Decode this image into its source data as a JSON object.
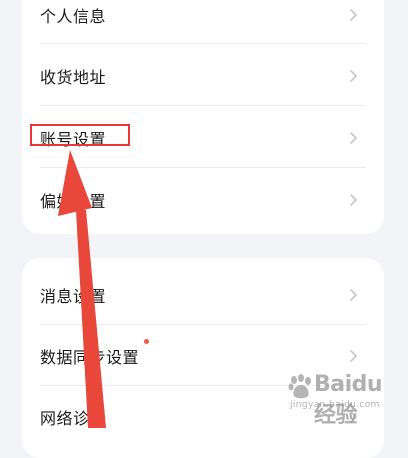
{
  "settings_card_1": {
    "items": [
      {
        "label": "个人信息"
      },
      {
        "label": "收货地址"
      },
      {
        "label": "账号设置"
      },
      {
        "label": "偏好设置"
      }
    ]
  },
  "settings_card_2": {
    "items": [
      {
        "label": "消息设置",
        "has_dot": false
      },
      {
        "label": "数据同步设置",
        "has_dot": true
      },
      {
        "label": "网络诊断",
        "has_dot": false
      }
    ]
  },
  "annotation": {
    "highlight_color": "#e8363a",
    "arrow_color": "#e8473a",
    "highlighted_item": "账号设置"
  },
  "colors": {
    "background": "#f3f4f8",
    "card": "#ffffff",
    "badge_dot": "#ef5a43",
    "chevron": "#c6c6c8"
  },
  "watermark": {
    "brand": "Baidu经验",
    "url": "jingyan.baidu.com"
  }
}
